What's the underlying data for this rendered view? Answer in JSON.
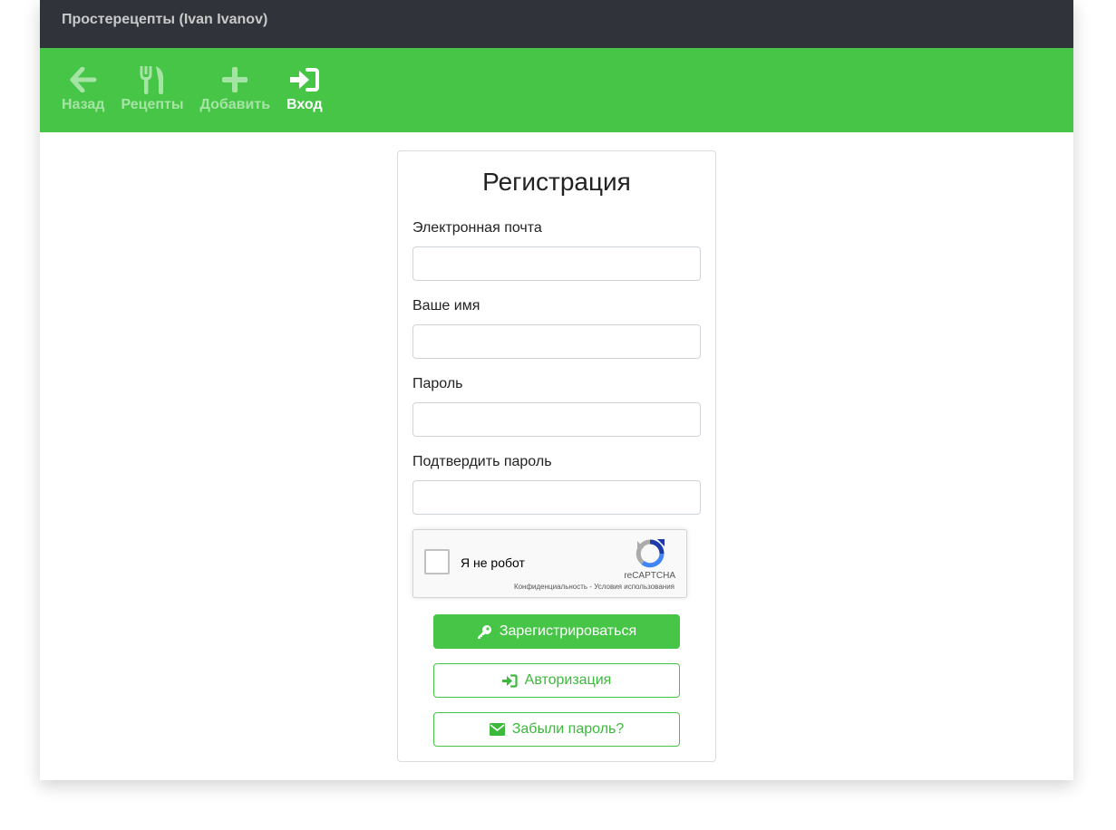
{
  "app": {
    "title": "Простерецепты (Ivan Ivanov)"
  },
  "nav": {
    "items": [
      {
        "label": "Назад",
        "icon": "arrow-left-icon"
      },
      {
        "label": "Рецепты",
        "icon": "utensils-icon"
      },
      {
        "label": "Добавить",
        "icon": "plus-icon"
      },
      {
        "label": "Вход",
        "icon": "sign-in-icon",
        "active": true
      }
    ]
  },
  "form": {
    "title": "Регистрация",
    "email_label": "Электронная почта",
    "email_value": "",
    "name_label": "Ваше имя",
    "name_value": "",
    "password_label": "Пароль",
    "password_value": "",
    "confirm_label": "Подтвердить пароль",
    "confirm_value": ""
  },
  "recaptcha": {
    "label": "Я не робот",
    "brand": "reCAPTCHA",
    "links": "Конфиденциальность - Условия использования"
  },
  "buttons": {
    "register": "Зарегистрироваться",
    "login": "Авторизация",
    "forgot": "Забыли пароль?"
  },
  "colors": {
    "topbar": "#30343a",
    "accent": "#46c546",
    "nav_inactive": "#a6e4a6"
  }
}
